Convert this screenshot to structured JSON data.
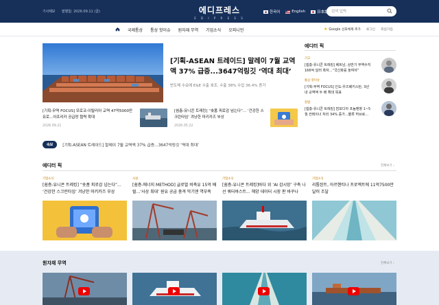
{
  "header": {
    "meta": {
      "report_link": "기사제보",
      "published": "발행일: 2026.09.11 (금)"
    },
    "logo": {
      "main": "에디프레스",
      "sub": "E D I P R E S S"
    },
    "languages": [
      {
        "label": "한국어",
        "flag_color": "#ffffff"
      },
      {
        "label": "English",
        "flag_color": "#b22234"
      },
      {
        "label": "日本語",
        "flag_color": "#ffffff"
      }
    ],
    "search": {
      "placeholder": "검색 입력"
    },
    "colors": {
      "bar": "#17305a",
      "accent": "#c47a00"
    }
  },
  "nav": {
    "items": [
      "국제통상",
      "통상 핫이슈",
      "원자재 무역",
      "기업소식",
      "오피니언"
    ],
    "google_badge": "Google 선호체제 추가",
    "login": "로그인",
    "signup": "회원가입"
  },
  "hero": {
    "title": "[기획-ASEAN 트레이드] 말레이 7월 교역액 37% 급증...3647억링깃 ‘역대 최대’",
    "summary": "반도체 수요에 E&E 수출 호조, 수출 38% 수입 36.4% 증가"
  },
  "sub_articles": [
    {
      "title": "[기획-무역 FOCUS] 모로코-이탈리아 교역 47억5000만유로...아프리카 공급망 협력 확대",
      "date": "2026.09.21"
    },
    {
      "title": "[쉼층-유니콘 트레킹] “숏폼 피로감 넘는다”... ‘건강한 스크린타임’ 겨냥한 마키카즈 부상",
      "date": "2026.05.22"
    }
  ],
  "editor_side": {
    "title": "에디터 픽",
    "items": [
      {
        "category": "기고",
        "title": "[쉼층-유니콘 트레킹] 베트남, 상반기 무역수지 166억 달러 흑자...“국신화를 놓여야”"
      },
      {
        "category": "통상 핫이슈",
        "title": "[기획-무역 FOCUS] 인도-우즈베키스탄, 3년 내 교역액 두 배 확대 목표"
      },
      {
        "category": "칼럼",
        "title": "[쉼층-유니콘 트레킹] 캄보디아 프놈펜항 1~5월 컨테이너 처리 34% 증가...물류 허브로..."
      }
    ]
  },
  "breaking": {
    "badge": "속보",
    "text": "[기획-ASEAN 트레이드] 말레이 7월 교역액 37% 급증...3647억링깃 ‘역대 최대’"
  },
  "editor_pick": {
    "title": "에디터 픽",
    "more": "전체보기 ›",
    "cards": [
      {
        "category": "기업소식",
        "title": "[쉼층-유니콘 트레킹] “숏폼 피로감 넘는다”... ‘건강한 스크린타임’ 겨냥한 마키카즈 부상"
      },
      {
        "category": "사설",
        "title": "[쉼층-에너지 METHOD] 글로벌 비축유 15억 배럴...‘사상 최대’ 원유 공급 충격 막기엔 역부족"
      },
      {
        "category": "기업소식",
        "title": "[쉼층-유니콘 트레킹]바다 위 ‘AI 감시망’ 구축 나선 쿼터바스트... 해양 데이터 시장 판 바꾸나"
      },
      {
        "category": "기업소식",
        "title": "리튬된트, 아르헨티나 프로젝트에 11억7500만달러 조달"
      }
    ]
  },
  "commodity": {
    "title": "원자재 무역",
    "more": "전체보기 ›"
  }
}
